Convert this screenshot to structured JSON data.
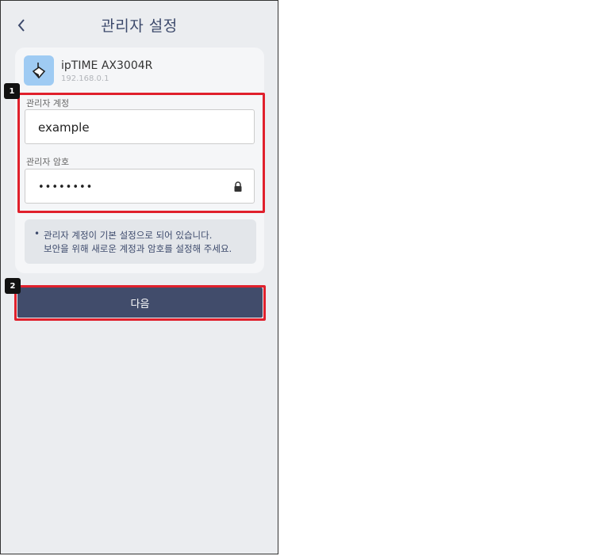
{
  "header": {
    "title": "관리자 설정",
    "back_icon": "chevron-left-icon"
  },
  "device": {
    "name": "ipTIME AX3004R",
    "ip": "192.168.0.1",
    "icon": "router-icon",
    "icon_color": "#9fcbf3"
  },
  "form": {
    "account_label": "관리자 계정",
    "account_value": "example",
    "password_label": "관리자 암호",
    "password_value": "••••••••",
    "lock_icon": "lock-icon"
  },
  "notice": {
    "bullet": "•",
    "line1": "관리자 계정이 기본 설정으로 되어 있습니다.",
    "line2": "보안을 위해 새로운 계정과 암호를 설정해 주세요."
  },
  "next_button": {
    "label": "다음",
    "color": "#414c6b"
  },
  "annotations": {
    "marker1": "1",
    "marker2": "2",
    "highlight_color": "#e0202c"
  }
}
